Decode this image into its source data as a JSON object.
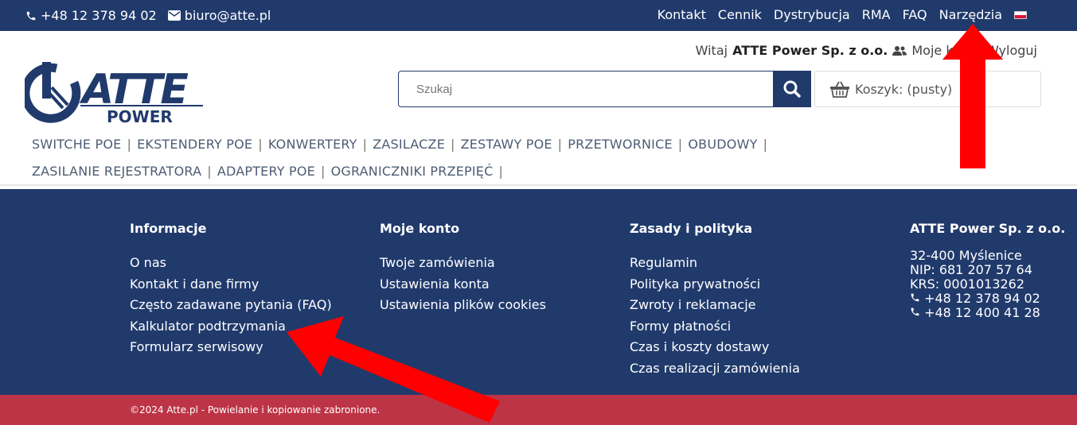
{
  "topbar": {
    "phone": "+48 12 378 94 02",
    "email": "biuro@atte.pl",
    "links": [
      "Kontakt",
      "Cennik",
      "Dystrybucja",
      "RMA",
      "FAQ",
      "Narzędzia"
    ]
  },
  "header": {
    "welcome_prefix": "Witaj",
    "company_name": "ATTE Power Sp. z o.o.",
    "account_link": "Moje konto",
    "logout_link": "Wyloguj",
    "logo_text": "ATTE",
    "logo_sub": "POWER"
  },
  "search": {
    "placeholder": "Szukaj"
  },
  "cart": {
    "label": "Koszyk: (pusty)"
  },
  "categories": {
    "row1": [
      "SWITCHE POE",
      "EKSTENDERY POE",
      "KONWERTERY",
      "ZASILACZE",
      "ZESTAWY POE",
      "PRZETWORNICE",
      "OBUDOWY"
    ],
    "row2": [
      "ZASILANIE REJESTRATORA",
      "ADAPTERY POE",
      "OGRANICZNIKI PRZEPIĘĆ"
    ]
  },
  "footer": {
    "info": {
      "title": "Informacje",
      "items": [
        "O nas",
        "Kontakt i dane firmy",
        "Często zadawane pytania (FAQ)",
        "Kalkulator podtrzymania",
        "Formularz serwisowy"
      ]
    },
    "account": {
      "title": "Moje konto",
      "items": [
        "Twoje zamówienia",
        "Ustawienia konta",
        "Ustawienia plików cookies"
      ]
    },
    "policy": {
      "title": "Zasady i polityka",
      "items": [
        "Regulamin",
        "Polityka prywatności",
        "Zwroty i reklamacje",
        "Formy płatności",
        "Czas i koszty dostawy",
        "Czas realizacji zamówienia"
      ]
    },
    "company": {
      "title": "ATTE Power Sp. z o.o.",
      "address": "32-400 Myślenice",
      "nip": "NIP: 681 207 57 64",
      "krs": "KRS: 0001013262",
      "phone1": "+48 12 378 94 02",
      "phone2": "+48 12 400 41 28"
    },
    "copyright": "©2024 Atte.pl - Powielanie i kopiowanie zabronione."
  },
  "colors": {
    "navy": "#213a6c",
    "crimson": "#bd3446",
    "arrow": "#ff0000"
  }
}
